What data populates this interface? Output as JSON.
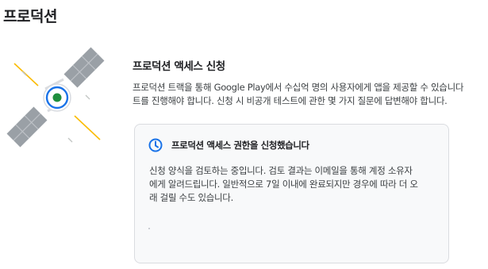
{
  "page": {
    "title": "프로덕션"
  },
  "section": {
    "title": "프로덕션 액세스 신청",
    "description_lines": [
      "프로덕션 트랙을 통해 Google Play에서 수십억 명의 사용자에게 앱을 제공할 수 있습니다",
      "트를 진행해야 합니다. 신청 시 비공개 테스트에 관한 몇 가지 질문에 답변해야 합니다."
    ]
  },
  "status_card": {
    "title": "프로덕션 액세스 권한을 신청했습니다",
    "body_lines": [
      "신청 양식을 검토하는 중입니다. 검토 결과는 이메일을 통해 계정 소유자",
      "에게 알려드립니다. 일반적으로 7일 이내에 완료되지만 경우에 따라 더 오",
      "래 걸릴 수도 있습니다."
    ]
  },
  "icons": {
    "illustration": "satellite-illustration",
    "status": "clock-icon"
  },
  "colors": {
    "accent_blue": "#1a73e8",
    "accent_green": "#1e8e3e",
    "accent_yellow": "#fbbc04",
    "panel_gray": "#9aa0a6"
  }
}
